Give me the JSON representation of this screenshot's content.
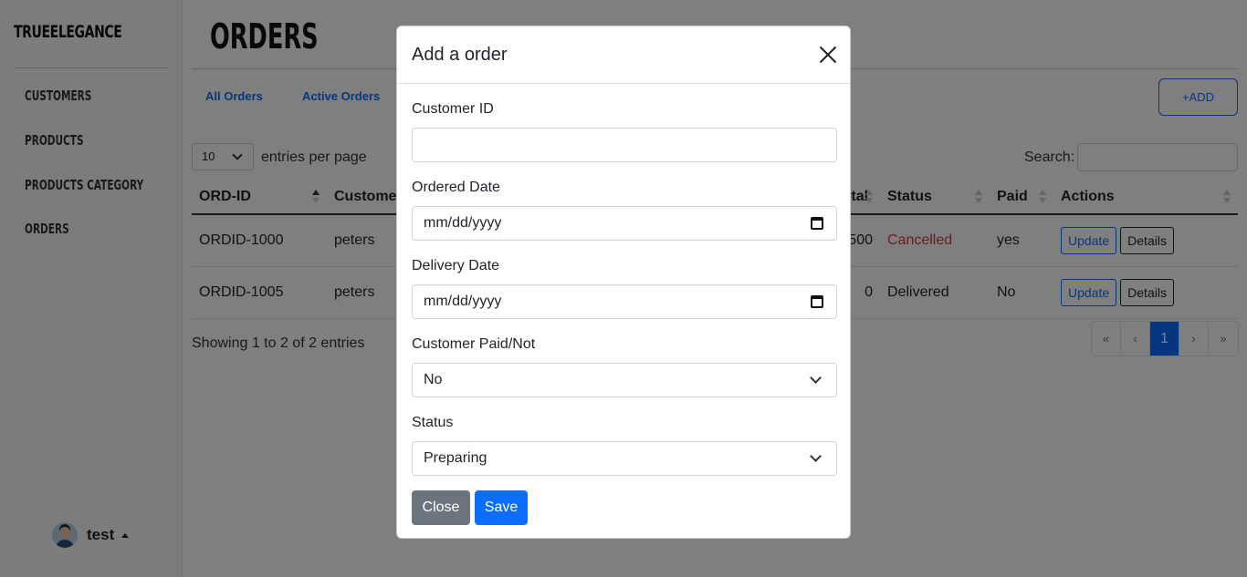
{
  "sidebar": {
    "brand": "TRUEELEGANCE",
    "items": [
      {
        "label": "CUSTOMERS"
      },
      {
        "label": "PRODUCTS"
      },
      {
        "label": "PRODUCTS CATEGORY"
      },
      {
        "label": "ORDERS"
      }
    ],
    "user": "test"
  },
  "main": {
    "title": "ORDERS",
    "tabs": [
      "All Orders",
      "Active Orders"
    ],
    "add_label": "+ADD",
    "entries_value": "10",
    "entries_label": "entries per page",
    "search_label": "Search:",
    "columns": [
      "ORD-ID",
      "Customer",
      "Total",
      "Status",
      "Paid",
      "Actions"
    ],
    "rows": [
      {
        "id": "ORDID-1000",
        "customer": "peters",
        "total": "500",
        "status": "Cancelled",
        "paid": "yes"
      },
      {
        "id": "ORDID-1005",
        "customer": "peters",
        "total": "0",
        "status": "Delivered",
        "paid": "No"
      }
    ],
    "update_label": "Update",
    "details_label": "Details",
    "showing": "Showing 1 to 2 of 2 entries",
    "pager": [
      "«",
      "‹",
      "1",
      "›",
      "»"
    ]
  },
  "modal": {
    "title": "Add a order",
    "fields": {
      "customer_id": {
        "label": "Customer ID",
        "value": ""
      },
      "ordered_date": {
        "label": "Ordered Date",
        "value": "mm/dd/yyyy"
      },
      "delivery_date": {
        "label": "Delivery Date",
        "value": "mm/dd/yyyy"
      },
      "paid": {
        "label": "Customer Paid/Not",
        "value": "No"
      },
      "status": {
        "label": "Status",
        "value": "Preparing"
      }
    },
    "close_label": "Close",
    "save_label": "Save"
  },
  "colors": {
    "primary": "#0d6efd",
    "secondary": "#6c757d",
    "danger": "#dc3545"
  }
}
